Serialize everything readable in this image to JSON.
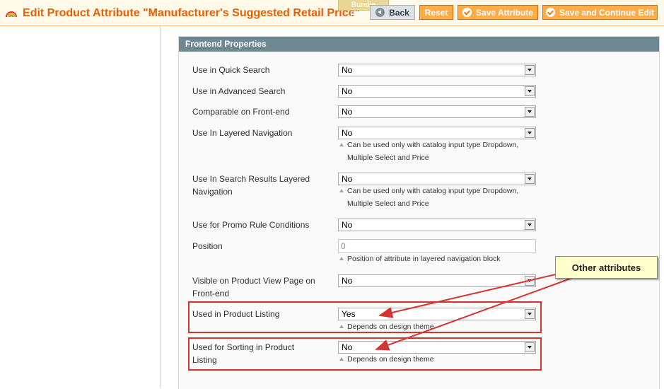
{
  "header": {
    "title": "Edit Product Attribute \"Manufacturer's Suggested Retail Price\"",
    "ghost_tab": "Bundle Product",
    "buttons": {
      "back": "Back",
      "reset": "Reset",
      "save": "Save Attribute",
      "save_continue": "Save and Continue Edit"
    }
  },
  "fieldset": {
    "title": "Frontend Properties",
    "fields": [
      {
        "label": "Use in Quick Search",
        "value": "No"
      },
      {
        "label": "Use in Advanced Search",
        "value": "No"
      },
      {
        "label": "Comparable on Front-end",
        "value": "No"
      },
      {
        "label": "Use In Layered Navigation",
        "value": "No",
        "note": [
          "Can be used only with catalog input type Dropdown,",
          "Multiple Select and Price"
        ]
      },
      {
        "label": [
          "Use In Search Results Layered",
          "Navigation"
        ],
        "value": "No",
        "note": [
          "Can be used only with catalog input type Dropdown,",
          "Multiple Select and Price"
        ]
      },
      {
        "label": "Use for Promo Rule Conditions",
        "value": "No"
      },
      {
        "label": "Position",
        "value": "0",
        "note": [
          "Position of attribute in layered navigation block"
        ]
      },
      {
        "label": [
          "Visible on Product View Page on",
          "Front-end"
        ],
        "value": "No"
      },
      {
        "label": "Used in Product Listing",
        "value": "Yes",
        "note": [
          "Depends on design theme"
        ]
      },
      {
        "label": [
          "Used for Sorting in Product",
          "Listing"
        ],
        "value": "No",
        "note": [
          "Depends on design theme"
        ]
      }
    ]
  },
  "callout": "Other attributes",
  "colors": {
    "title_orange": "#eb5e00",
    "button_orange": "#ffac47",
    "fieldset_header": "#6f8992",
    "highlight_red": "#d63333",
    "callout_bg": "#ffffcc"
  }
}
